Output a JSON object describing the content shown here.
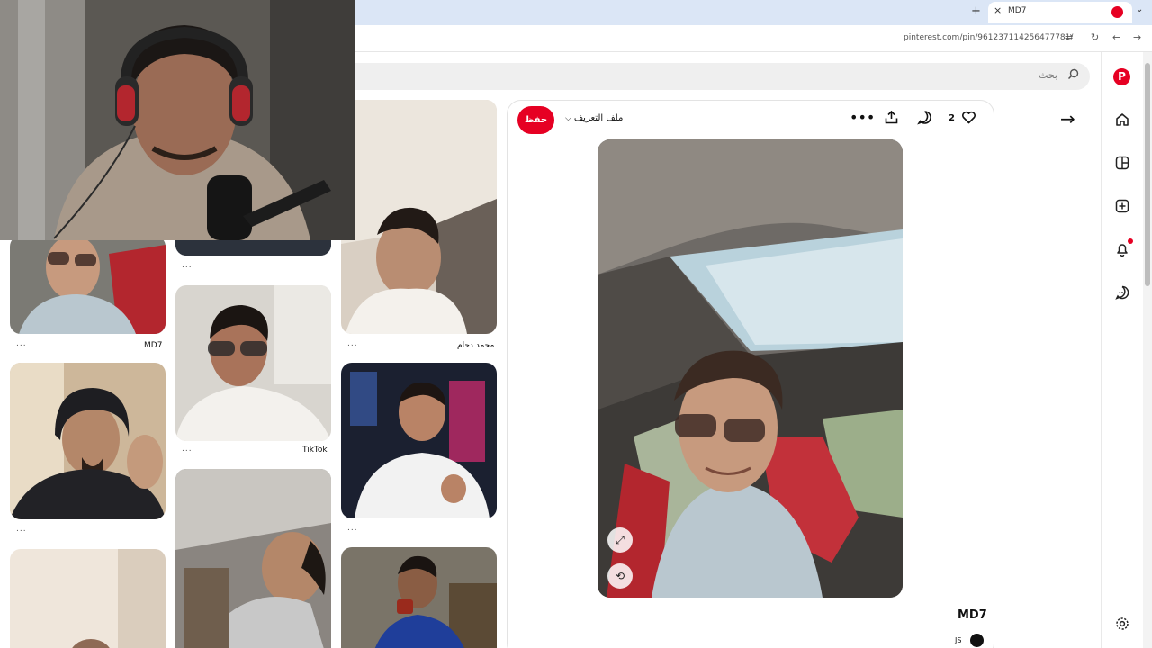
{
  "browser": {
    "tab_title": "MD7",
    "url": "pinterest.com/pin/961237114256477781/",
    "new_tab_icon": "+",
    "tab_close_icon": "×",
    "tabs_menu_icon": "⌄"
  },
  "search": {
    "placeholder": "بحث"
  },
  "pin": {
    "save_label": "حفظ",
    "profile_label": "ملف التعريف",
    "likes": "2",
    "title": "MD7",
    "author": "JS"
  },
  "grid": {
    "captions": [
      "MD7",
      "محمد دحام",
      "TikTok"
    ],
    "more": "..."
  },
  "colors": {
    "brand": "#e60023",
    "tabbar": "#dbe6f6"
  },
  "icons": [
    "pinterest-logo-icon",
    "home-icon",
    "explore-icon",
    "create-icon",
    "bell-icon",
    "message-icon",
    "settings-icon",
    "heart-icon",
    "comment-icon",
    "share-icon",
    "more-icon",
    "back-arrow-icon",
    "search-icon",
    "expand-icon",
    "visual-search-icon",
    "reload-icon",
    "nav-back-icon",
    "nav-forward-icon"
  ]
}
